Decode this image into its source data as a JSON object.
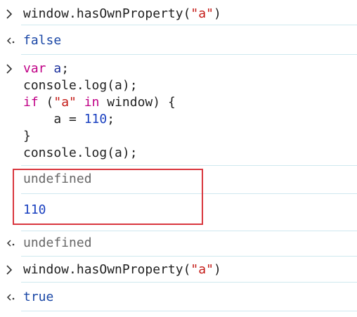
{
  "console": {
    "entry1": {
      "prefix": "window.hasOwnProperty(",
      "arg": "\"a\"",
      "suffix": ")"
    },
    "result1": "false",
    "entry2": {
      "l1_kw": "var",
      "l1_var": "a",
      "l1_end": ";",
      "l2": "console.log(a);",
      "l3_kw": "if",
      "l3_open": " (",
      "l3_str": "\"a\"",
      "l3_in": " in",
      "l3_rest": " window) {",
      "l4_pre": "    a = ",
      "l4_num": "110",
      "l4_end": ";",
      "l5": "}",
      "l6": "console.log(a);"
    },
    "log1": "undefined",
    "log2": "110",
    "result2": "undefined",
    "entry3": {
      "prefix": "window.hasOwnProperty(",
      "arg": "\"a\"",
      "suffix": ")"
    },
    "result3": "true"
  },
  "colors": {
    "keyword": "#c00086",
    "string": "#c41a16",
    "number": "#1a40c0",
    "highlight_border": "#d9363e"
  },
  "icons": {
    "prompt": "chevron-right-icon",
    "result": "return-arrow-icon"
  }
}
